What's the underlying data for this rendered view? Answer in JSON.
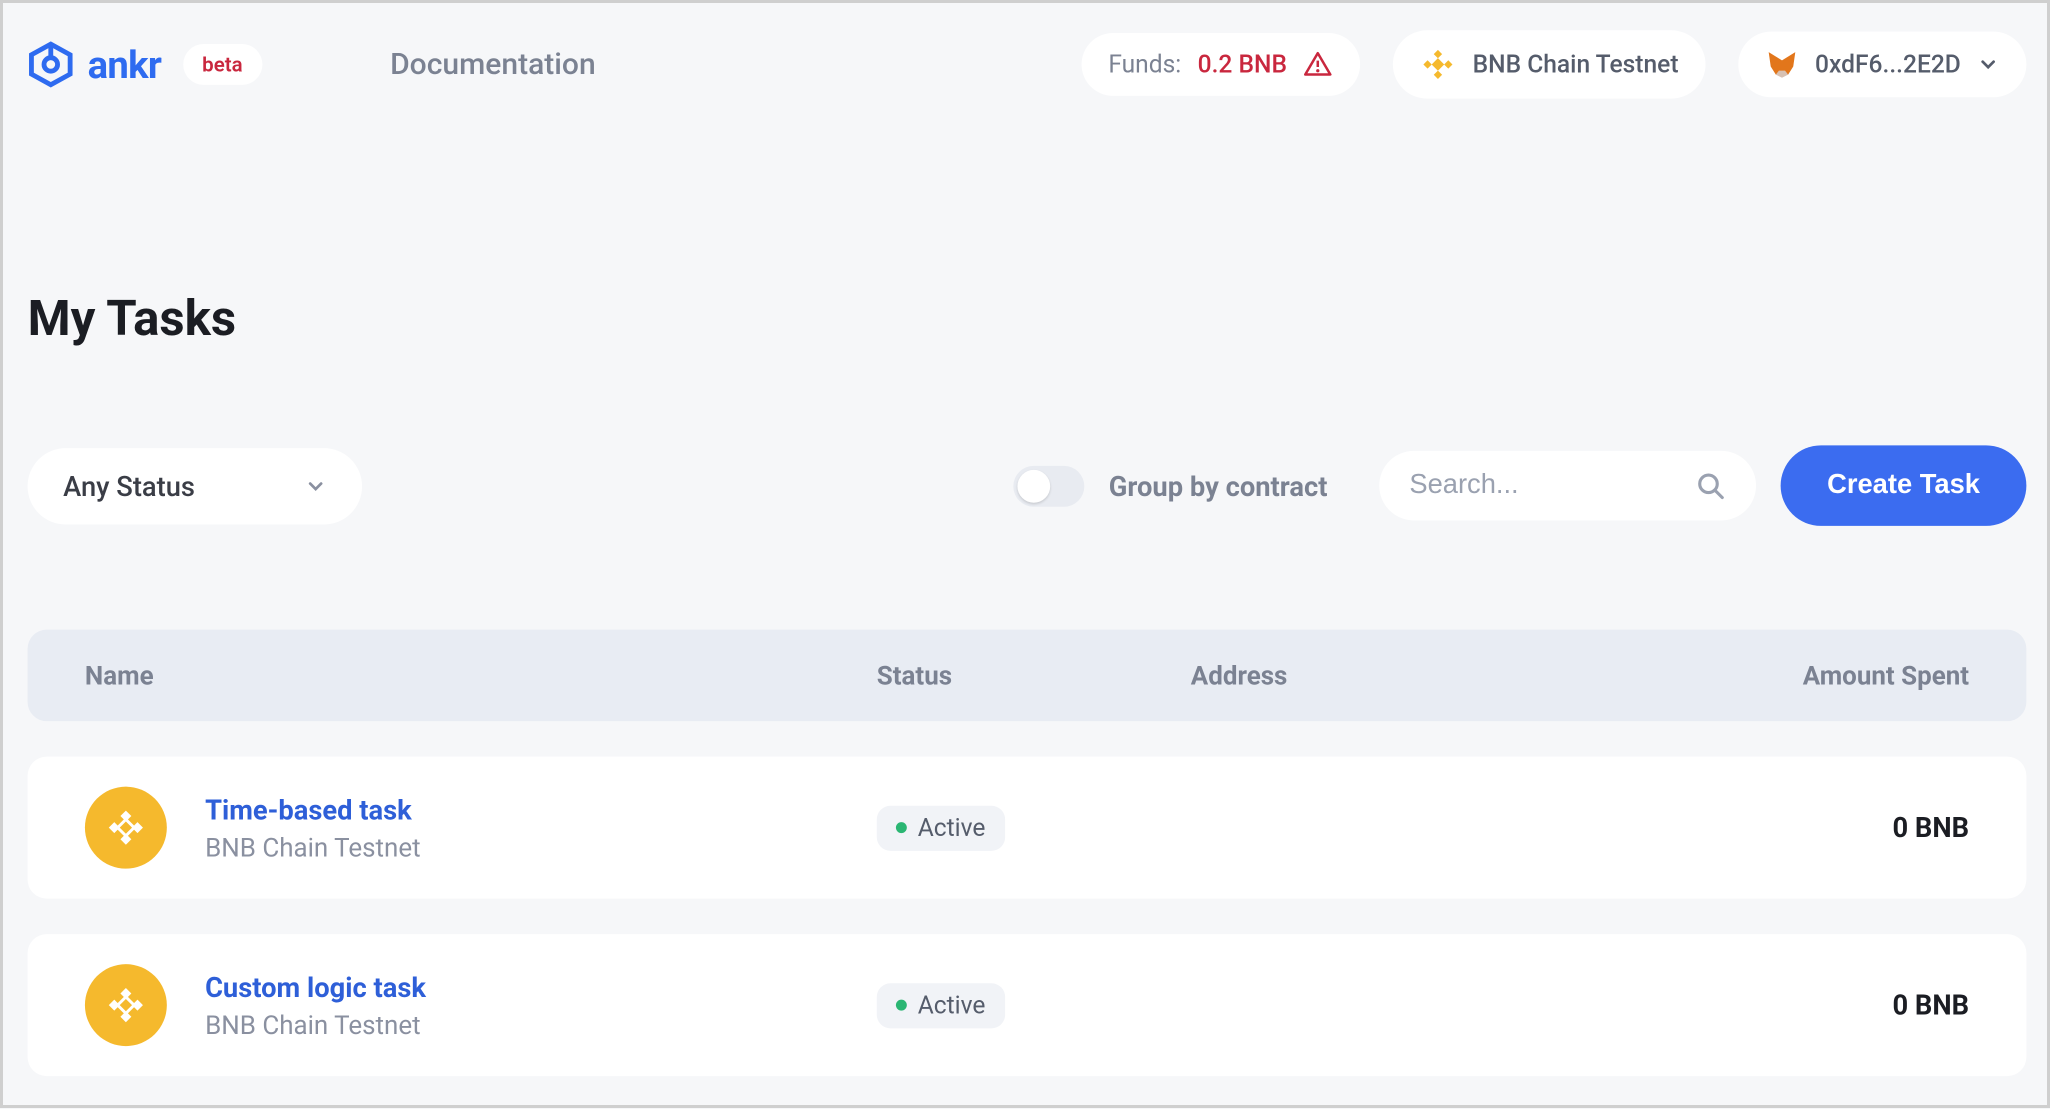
{
  "header": {
    "brand": "ankr",
    "beta_label": "beta",
    "doc_link": "Documentation",
    "funds_label": "Funds: ",
    "funds_value": "0.2 BNB",
    "chain_name": "BNB Chain Testnet",
    "wallet_address": "0xdF6...2E2D"
  },
  "page": {
    "title": "My Tasks"
  },
  "controls": {
    "status_filter": "Any Status",
    "group_by_label": "Group by contract",
    "search_placeholder": "Search...",
    "create_button": "Create Task"
  },
  "table": {
    "headers": {
      "name": "Name",
      "status": "Status",
      "address": "Address",
      "amount": "Amount Spent"
    }
  },
  "tasks": [
    {
      "name": "Time-based task",
      "chain": "BNB Chain Testnet",
      "status": "Active",
      "address": "",
      "amount": "0 BNB"
    },
    {
      "name": "Custom logic task",
      "chain": "BNB Chain Testnet",
      "status": "Active",
      "address": "",
      "amount": "0 BNB"
    }
  ]
}
